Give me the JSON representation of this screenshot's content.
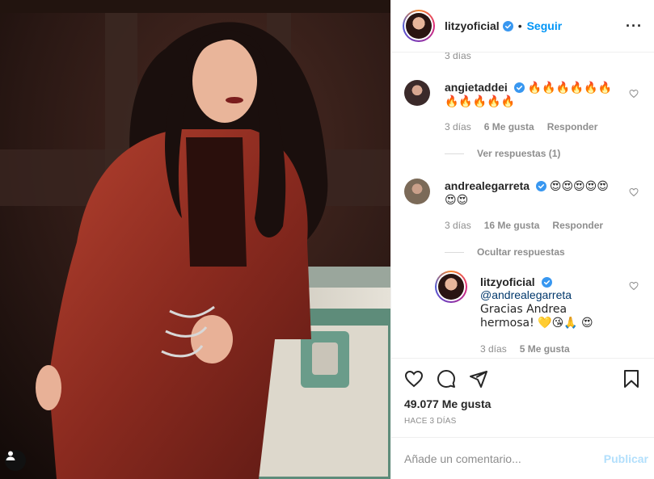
{
  "header": {
    "username": "litzyoficial",
    "separator": "•",
    "follow_label": "Seguir",
    "more_label": "···"
  },
  "comments": {
    "top_time": "3 días",
    "items": [
      {
        "username": "angietaddei",
        "text": "🔥🔥🔥🔥🔥🔥🔥🔥🔥🔥🔥",
        "time": "3 días",
        "likes": "6 Me gusta",
        "reply_label": "Responder",
        "replies_toggle": "Ver respuestas (1)"
      },
      {
        "username": "andrealegarreta",
        "text": "😍😍😍😍😍😍😍",
        "time": "3 días",
        "likes": "16 Me gusta",
        "reply_label": "Responder",
        "replies_toggle": "Ocultar respuestas"
      }
    ],
    "reply": {
      "username": "litzyoficial",
      "mention": "@andrealegarreta",
      "text": " Gracias Andrea hermosa! 💛😘🙏 😍",
      "time": "3 días",
      "likes": "5 Me gusta"
    }
  },
  "actions": {
    "likes": "49.077 Me gusta",
    "date": "HACE 3 DÍAS",
    "comment_placeholder": "Añade un comentario...",
    "post_label": "Publicar"
  },
  "icons": [
    "verified-badge-icon",
    "heart-icon",
    "comment-icon",
    "share-icon",
    "bookmark-icon",
    "user-tag-icon",
    "more-icon"
  ],
  "colors": {
    "link": "#0095f6",
    "verified": "#3897f0",
    "muted": "#8e8e8e",
    "post_disabled": "#b2dffc"
  }
}
